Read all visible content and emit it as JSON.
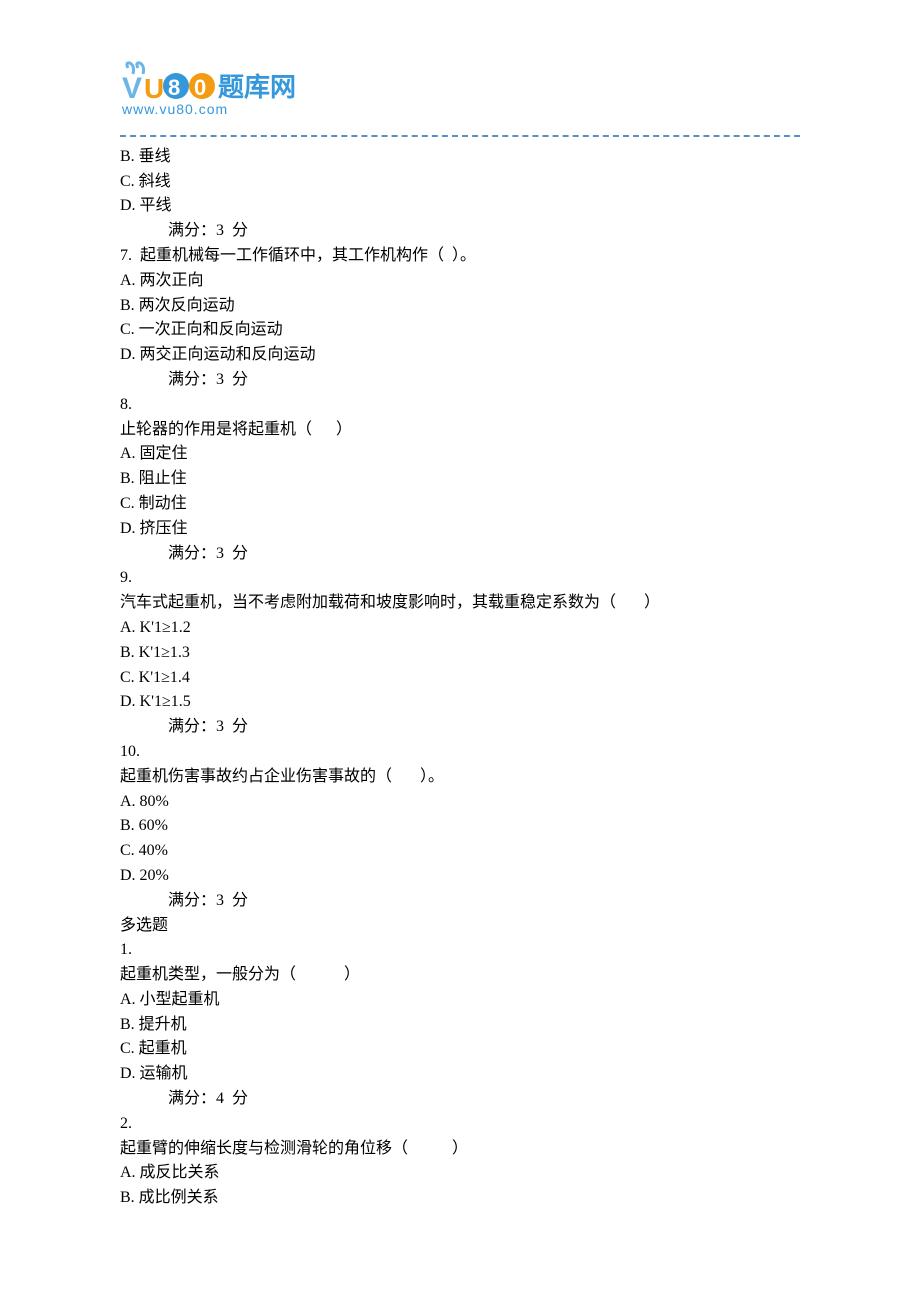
{
  "logo": {
    "textMain": "题库网",
    "textSub": "www.vu80.com"
  },
  "lines": [
    {
      "text": "B. 垂线"
    },
    {
      "text": "C. 斜线"
    },
    {
      "text": "D. 平线"
    },
    {
      "text": "满分：3  分",
      "indent": true
    },
    {
      "text": "7.  起重机械每一工作循环中，其工作机构作（  ）。"
    },
    {
      "text": "A. 两次正向"
    },
    {
      "text": "B. 两次反向运动"
    },
    {
      "text": "C. 一次正向和反向运动"
    },
    {
      "text": "D. 两交正向运动和反向运动"
    },
    {
      "text": "满分：3  分",
      "indent": true
    },
    {
      "text": "8."
    },
    {
      "text": "止轮器的作用是将起重机（      ）"
    },
    {
      "text": "A. 固定住"
    },
    {
      "text": "B. 阻止住"
    },
    {
      "text": "C. 制动住"
    },
    {
      "text": "D. 挤压住"
    },
    {
      "text": "满分：3  分",
      "indent": true
    },
    {
      "text": "9."
    },
    {
      "text": "汽车式起重机，当不考虑附加载荷和坡度影响时，其载重稳定系数为（       ）"
    },
    {
      "text": "A. K'1≥1.2"
    },
    {
      "text": "B. K'1≥1.3"
    },
    {
      "text": "C. K'1≥1.4"
    },
    {
      "text": "D. K'1≥1.5"
    },
    {
      "text": "满分：3  分",
      "indent": true
    },
    {
      "text": "10."
    },
    {
      "text": "起重机伤害事故约占企业伤害事故的（       ）。"
    },
    {
      "text": "A. 80%"
    },
    {
      "text": "B. 60%"
    },
    {
      "text": "C. 40%"
    },
    {
      "text": "D. 20%"
    },
    {
      "text": "满分：3  分",
      "indent": true
    },
    {
      "text": "多选题"
    },
    {
      "text": "1."
    },
    {
      "text": "起重机类型，一般分为（            ）"
    },
    {
      "text": "A. 小型起重机"
    },
    {
      "text": "B. 提升机"
    },
    {
      "text": "C. 起重机"
    },
    {
      "text": "D. 运输机"
    },
    {
      "text": "满分：4  分",
      "indent": true
    },
    {
      "text": "2."
    },
    {
      "text": "起重臂的伸缩长度与检测滑轮的角位移（           ）"
    },
    {
      "text": "A. 成反比关系"
    },
    {
      "text": "B. 成比例关系"
    }
  ]
}
